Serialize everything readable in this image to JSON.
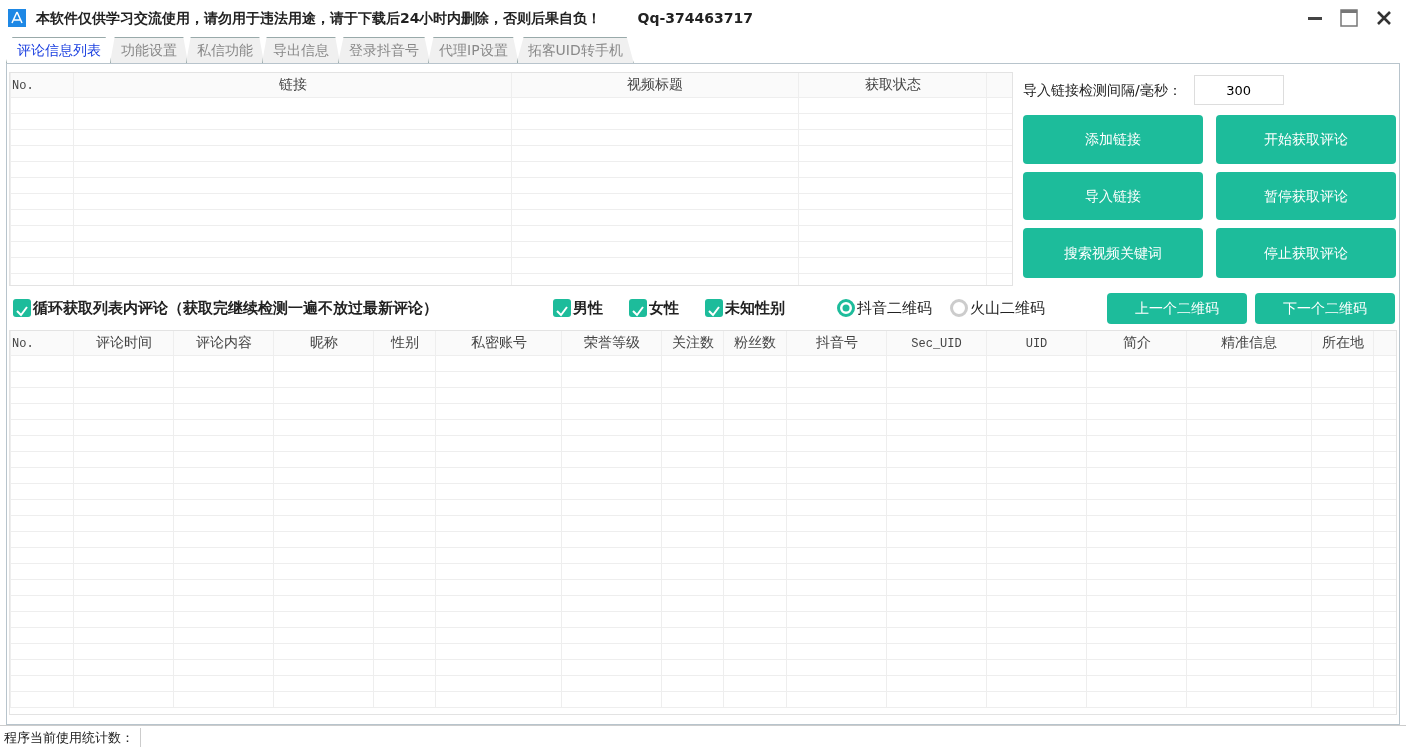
{
  "window": {
    "title": "本软件仅供学习交流使用，请勿用于违法用途，请于下载后24小时内删除，否则后果自负！",
    "contact": "Qq-374463717"
  },
  "tabs": [
    {
      "label": "评论信息列表",
      "selected": true
    },
    {
      "label": "功能设置",
      "selected": false
    },
    {
      "label": "私信功能",
      "selected": false
    },
    {
      "label": "导出信息",
      "selected": false
    },
    {
      "label": "登录抖音号",
      "selected": false
    },
    {
      "label": "代理IP设置",
      "selected": false
    },
    {
      "label": "拓客UID转手机",
      "selected": false
    }
  ],
  "link_table": {
    "columns": [
      "No.",
      "链接",
      "视频标题",
      "获取状态"
    ]
  },
  "interval": {
    "label": "导入链接检测间隔/毫秒：",
    "value": "300"
  },
  "action_buttons": [
    "添加链接",
    "开始获取评论",
    "导入链接",
    "暂停获取评论",
    "搜索视频关键词",
    "停止获取评论"
  ],
  "options": {
    "loop": {
      "label": "循环获取列表内评论（获取完继续检测一遍不放过最新评论）",
      "checked": true
    },
    "genders": [
      {
        "label": "男性",
        "checked": true
      },
      {
        "label": "女性",
        "checked": true
      },
      {
        "label": "未知性别",
        "checked": true
      }
    ],
    "qr_sources": [
      {
        "label": "抖音二维码",
        "selected": true
      },
      {
        "label": "火山二维码",
        "selected": false
      }
    ],
    "buttons": [
      "上一个二维码",
      "下一个二维码"
    ]
  },
  "comment_table": {
    "columns": [
      "No.",
      "评论时间",
      "评论内容",
      "昵称",
      "性别",
      "私密账号",
      "荣誉等级",
      "关注数",
      "粉丝数",
      "抖音号",
      "Sec_UID",
      "UID",
      "简介",
      "精准信息",
      "所在地"
    ]
  },
  "status_bar": {
    "label": "程序当前使用统计数："
  }
}
